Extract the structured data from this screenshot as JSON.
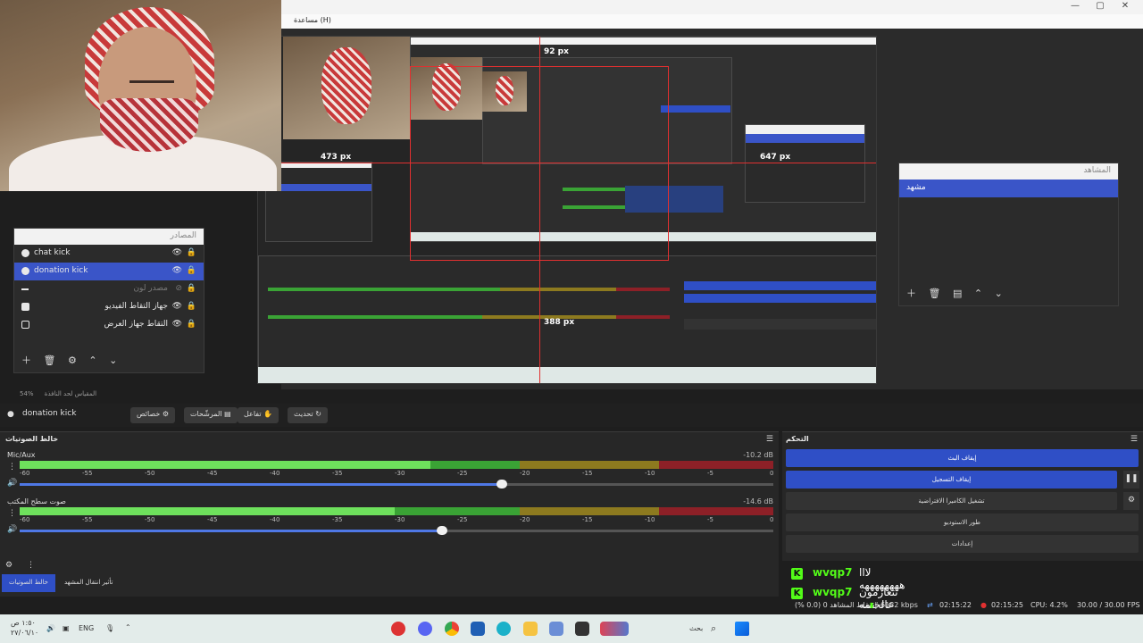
{
  "window": {
    "menu_help": "مساعدة (H)"
  },
  "canvas_labels": {
    "top_px": "92 px",
    "left_px": "473 px",
    "right_px": "647 px",
    "bottom_px": "388 px"
  },
  "sources": {
    "title": "المصادر",
    "items": [
      {
        "label": "chat kick",
        "icon": "browser-icon",
        "visible": true,
        "selected": false
      },
      {
        "label": "donation kick",
        "icon": "browser-icon",
        "visible": true,
        "selected": true
      },
      {
        "label": "مصدر لون",
        "icon": "brush-icon",
        "visible": false,
        "selected": false
      },
      {
        "label": "جهاز التقاط الفيديو",
        "icon": "camera-icon",
        "visible": true,
        "selected": false
      },
      {
        "label": "التقاط جهاز العرض",
        "icon": "monitor-icon",
        "visible": true,
        "selected": false
      }
    ]
  },
  "scenes": {
    "title": "المشاهد",
    "items": [
      "مشهد"
    ]
  },
  "status_top": {
    "zoom": "54%",
    "label": "المقياس لحد النافذة"
  },
  "selection": {
    "name": "donation kick",
    "refresh": "تحديث",
    "interact": "تفاعل",
    "filters": "المرشّحات",
    "properties": "خصائص"
  },
  "mixer": {
    "title": "خالط الصوتيات",
    "channels": [
      {
        "name": "Mic/Aux",
        "db": "-10.2 dB",
        "volume": 0.64
      },
      {
        "name": "صوت سطح المكتب",
        "db": "-14.6 dB",
        "volume": 0.56
      }
    ],
    "scale": [
      "-60",
      "-55",
      "-50",
      "-45",
      "-40",
      "-35",
      "-30",
      "-25",
      "-20",
      "-15",
      "-10",
      "-5",
      "0"
    ]
  },
  "bottom_tabs": {
    "mixer": "خالط الصوتيات",
    "transitions": "تأثير انتقال المشهد"
  },
  "controls": {
    "title": "التحكم",
    "stop_stream": "إيقاف البث",
    "stop_recording": "إيقاف التسجيل",
    "virtual_camera": "تشغيل الكاميرا الافتراضية",
    "studio_mode": "طور الاستوديو",
    "settings": "إعدادات"
  },
  "chat": [
    {
      "user": "wvqp7",
      "message": "لااا ههههههههه"
    },
    {
      "user": "wvqp7",
      "message": "تتعازمون عالختمه"
    }
  ],
  "obs_status": {
    "dropped": "إسقاط المشاهد 0 (0.0 %)",
    "bitrate": "6182 kbps",
    "stream_time": "02:15:22",
    "rec_time": "02:15:25",
    "cpu": "CPU: 4.2%",
    "fps": "30.00 / 30.00 FPS"
  },
  "taskbar": {
    "time": "١:٥٠ ص",
    "date": "٢٧/٠٦/١٠",
    "lang": "ENG",
    "search": "بحث"
  },
  "colors": {
    "accent": "#2f4fc6",
    "kick_green": "#53fc18",
    "guide_red": "#e03030"
  }
}
